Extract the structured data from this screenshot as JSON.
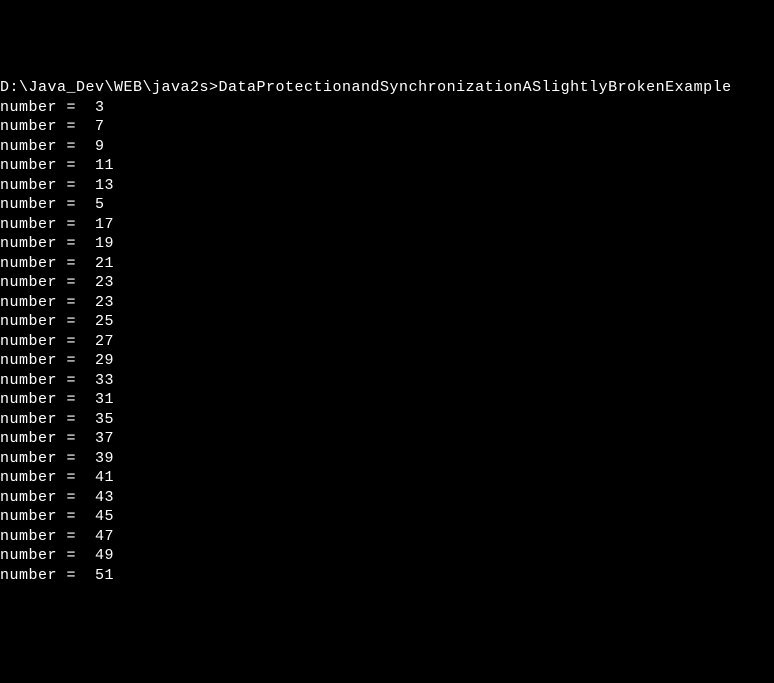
{
  "prompt": "D:\\Java_Dev\\WEB\\java2s>DataProtectionandSynchronizationASlightlyBrokenExample",
  "lines": [
    "number =  3",
    "number =  7",
    "number =  9",
    "number =  11",
    "number =  13",
    "number =  5",
    "number =  17",
    "number =  19",
    "number =  21",
    "number =  23",
    "number =  23",
    "number =  25",
    "number =  27",
    "number =  29",
    "number =  33",
    "number =  31",
    "number =  35",
    "number =  37",
    "number =  39",
    "number =  41",
    "number =  43",
    "number =  45",
    "number =  47",
    "number =  49",
    "number =  51"
  ]
}
